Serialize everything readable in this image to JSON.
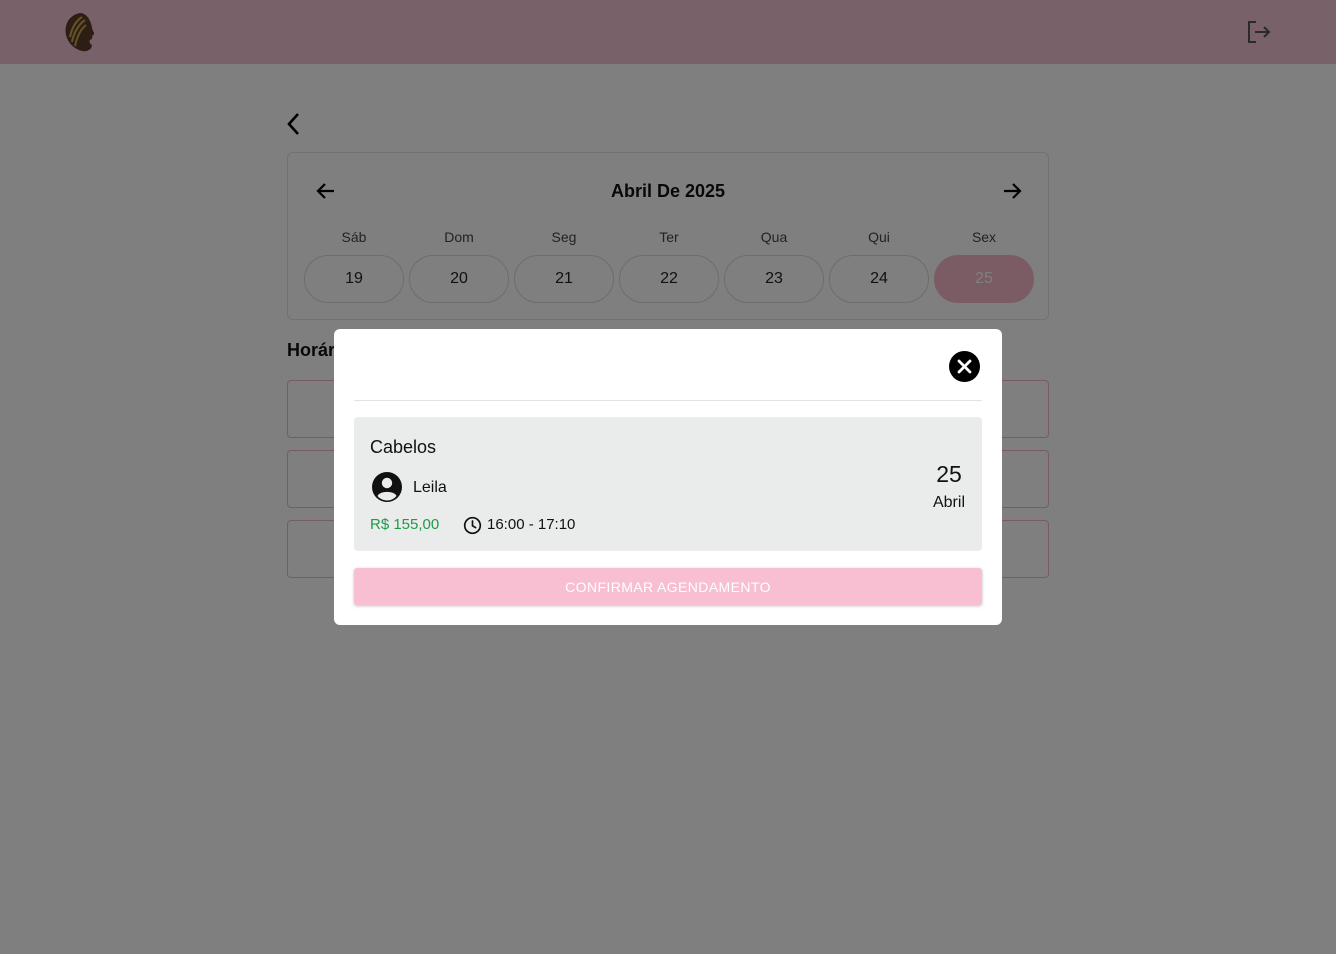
{
  "header": {
    "logo_icon": "woman-profile-logo-icon",
    "logout_icon": "logout-icon",
    "background_color": "#f3c2d2"
  },
  "navigation": {
    "back_icon": "chevron-left-icon"
  },
  "calendar": {
    "title": "Abril De 2025",
    "prev_icon": "arrow-left-icon",
    "next_icon": "arrow-right-icon",
    "weekdays": [
      "Sáb",
      "Dom",
      "Seg",
      "Ter",
      "Qua",
      "Qui",
      "Sex"
    ],
    "days": [
      "19",
      "20",
      "21",
      "22",
      "23",
      "24",
      "25"
    ],
    "selected_day": "25",
    "selected_color": "#f7b7c8"
  },
  "schedule": {
    "section_title": "Horár"
  },
  "modal": {
    "close_icon": "close-circle-icon",
    "service": "Cabelos",
    "professional_icon": "account-circle-icon",
    "professional": "Leila",
    "price": "R$ 155,00",
    "price_color": "#1e9a4a",
    "clock_icon": "clock-icon",
    "time": "16:00 - 17:10",
    "date_day": "25",
    "date_month": "Abril",
    "confirm_label": "CONFIRMAR AGENDAMENTO",
    "confirm_color": "#f7bfd1"
  }
}
